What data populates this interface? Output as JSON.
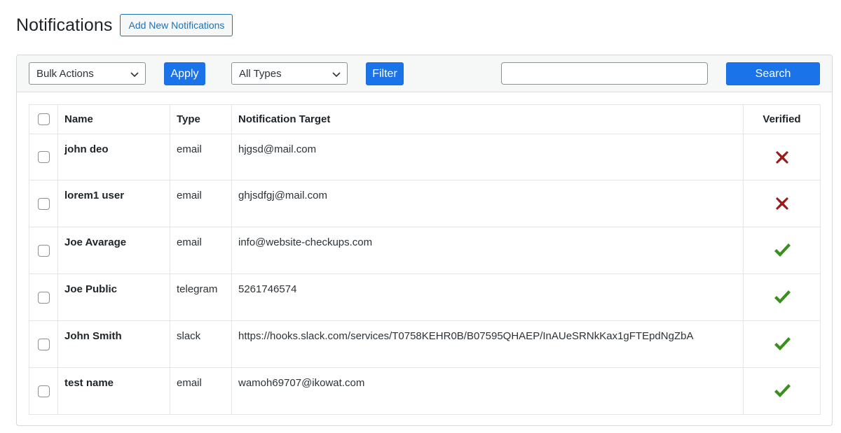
{
  "header": {
    "title": "Notifications",
    "add_button_label": "Add New Notifications"
  },
  "toolbar": {
    "bulk_actions": {
      "selected": "Bulk Actions"
    },
    "apply_label": "Apply",
    "types": {
      "selected": "All Types"
    },
    "filter_label": "Filter",
    "search": {
      "value": "",
      "placeholder": ""
    },
    "search_label": "Search"
  },
  "table": {
    "columns": {
      "name": "Name",
      "type": "Type",
      "target": "Notification Target",
      "verified": "Verified"
    },
    "rows": [
      {
        "name": "john deo",
        "type": "email",
        "target": "hjgsd@mail.com",
        "verified": false
      },
      {
        "name": "lorem1 user",
        "type": "email",
        "target": "ghjsdfgj@mail.com",
        "verified": false
      },
      {
        "name": "Joe Avarage",
        "type": "email",
        "target": "info@website-checkups.com",
        "verified": true
      },
      {
        "name": "Joe Public",
        "type": "telegram",
        "target": "5261746574",
        "verified": true
      },
      {
        "name": "John Smith",
        "type": "slack",
        "target": "https://hooks.slack.com/services/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",
        "verified": true
      },
      {
        "name": "test name",
        "type": "email",
        "target": "wamoh69707@ikowat.com",
        "verified": true
      }
    ]
  },
  "icons": {
    "verified_true": "check-icon",
    "verified_false": "cross-icon"
  },
  "colors": {
    "primary": "#1a73e8",
    "link": "#2271b1",
    "check": "#3a8f1e",
    "cross": "#9b1b1b"
  }
}
